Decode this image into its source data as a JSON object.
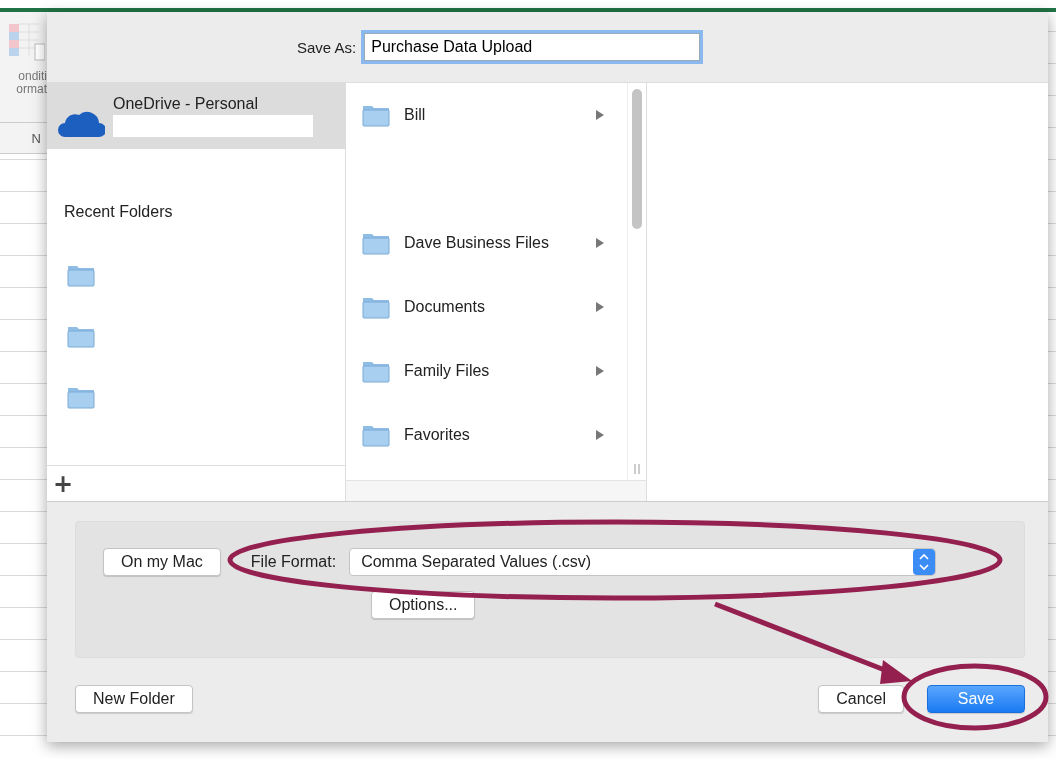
{
  "spreadsheet": {
    "ribbon_label_lines": [
      "onditi",
      "ormat"
    ],
    "column_header": "N"
  },
  "dialog": {
    "save_as_label": "Save As:",
    "file_name": "Purchase Data Upload",
    "sidebar": {
      "locations": [
        {
          "name": "OneDrive - Personal",
          "selected": true
        }
      ],
      "recent_folders_heading": "Recent Folders",
      "recent_folders": [
        {
          "kind": "folder"
        },
        {
          "kind": "folder"
        },
        {
          "kind": "folder"
        }
      ],
      "add_button": "+"
    },
    "folders": [
      {
        "kind": "folder",
        "name": "Bill",
        "has_children": true
      },
      {
        "kind": "blank"
      },
      {
        "kind": "folder",
        "name": "Dave Business Files",
        "has_children": true
      },
      {
        "kind": "folder",
        "name": "Documents",
        "has_children": true
      },
      {
        "kind": "folder",
        "name": "Family Files",
        "has_children": true
      },
      {
        "kind": "folder",
        "name": "Favorites",
        "has_children": true
      }
    ],
    "location_button": "On my Mac",
    "file_format_label": "File Format:",
    "file_format": "Comma Separated Values (.csv)",
    "options_button": "Options...",
    "new_folder_button": "New Folder",
    "cancel_button": "Cancel",
    "save_button": "Save"
  },
  "annotations": [
    {
      "kind": "ellipse"
    },
    {
      "kind": "arrow"
    },
    {
      "kind": "ellipse"
    }
  ]
}
